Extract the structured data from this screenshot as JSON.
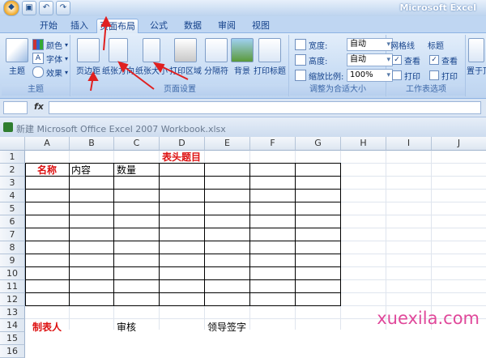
{
  "app_title": "Microsoft Excel",
  "tabs": [
    {
      "label": "开始"
    },
    {
      "label": "插入"
    },
    {
      "label": "页面布局"
    },
    {
      "label": "公式"
    },
    {
      "label": "数据"
    },
    {
      "label": "审阅"
    },
    {
      "label": "视图"
    }
  ],
  "ribbon": {
    "theme_group": {
      "label": "主题",
      "theme_button": "主题",
      "colors": "颜色",
      "fonts": "字体",
      "effects": "效果"
    },
    "page_setup_group": {
      "label": "页面设置",
      "margins": "页边距",
      "orientation": "纸张方向",
      "size": "纸张大小",
      "print_area": "打印区域",
      "breaks": "分隔符",
      "background": "背景",
      "print_titles": "打印标题"
    },
    "scale_group": {
      "label": "调整为合适大小",
      "width_label": "宽度:",
      "width_value": "自动",
      "height_label": "高度:",
      "height_value": "自动",
      "scale_label": "缩放比例:",
      "scale_value": "100%"
    },
    "sheet_options_group": {
      "label": "工作表选项",
      "gridlines": "网格线",
      "headings": "标题",
      "view": "查看",
      "print": "打印"
    },
    "arrange_partial": "置于顶"
  },
  "formula_bar": {
    "fx": "fx"
  },
  "workbook_title": "新建 Microsoft Office Excel 2007 Workbook.xlsx",
  "columns": [
    "A",
    "B",
    "C",
    "D",
    "E",
    "F",
    "G",
    "H",
    "I",
    "J"
  ],
  "rows": [
    "1",
    "2",
    "3",
    "4",
    "5",
    "6",
    "7",
    "8",
    "9",
    "10",
    "11",
    "12",
    "13",
    "14",
    "15",
    "16"
  ],
  "cells": {
    "title": "表头题目",
    "name": "名称",
    "content": "内容",
    "quantity": "数量",
    "maker": "制表人",
    "review": "审核",
    "leader_sign": "领导签字"
  },
  "watermark": "xuexila.com",
  "colors": {
    "ribbon_bg": "#c6dbf4",
    "accent_red": "#dd1111",
    "arrow_red": "#e02020"
  }
}
